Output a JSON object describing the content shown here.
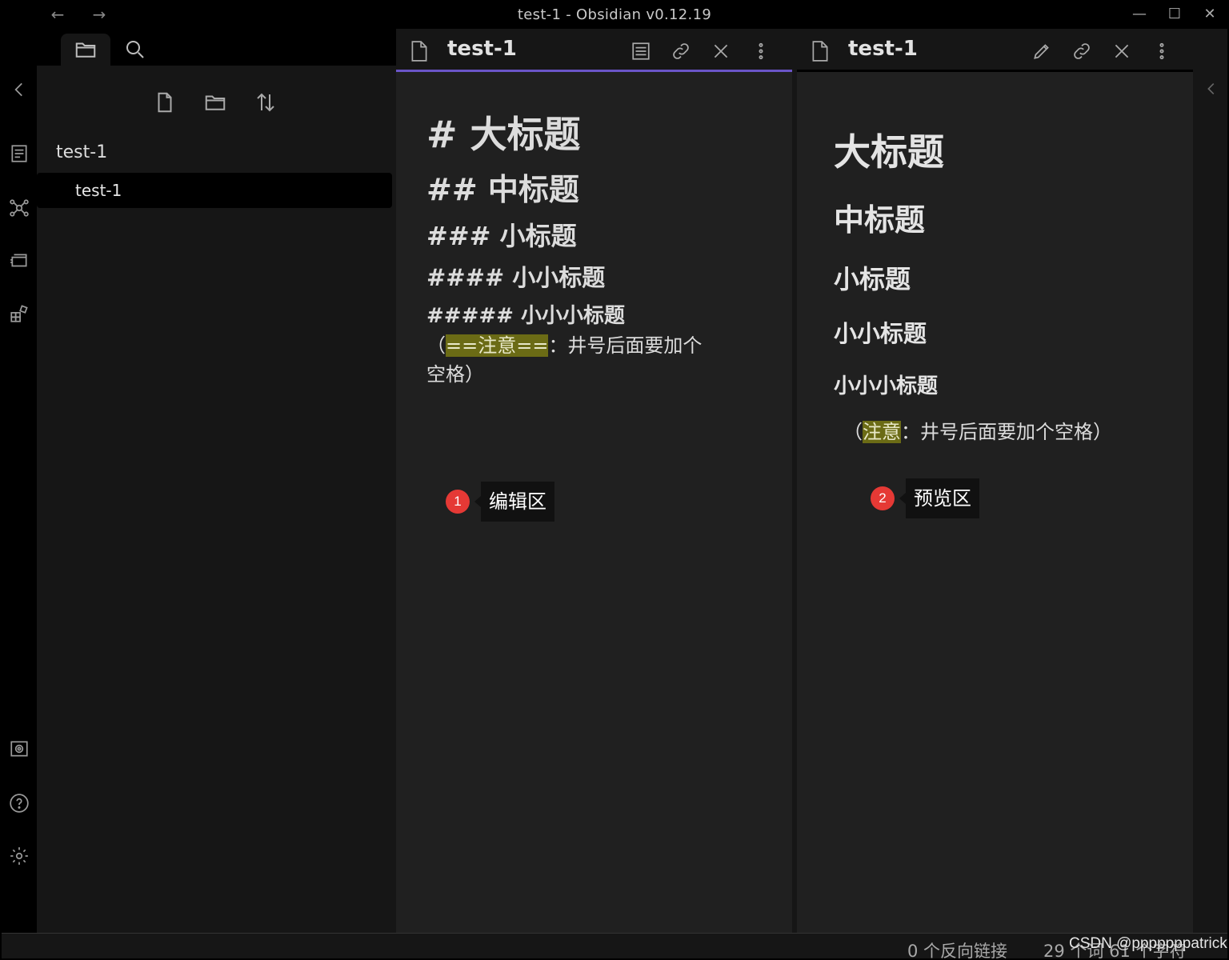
{
  "window": {
    "title": "test-1 - Obsidian v0.12.19"
  },
  "titlebar": {
    "back_icon": "arrow-left-icon",
    "forward_icon": "arrow-right-icon",
    "minimize": "—",
    "maximize": "☐",
    "close": "✕"
  },
  "ribbon": {
    "icons": [
      "collapse-left-icon",
      "quick-switcher-icon",
      "graph-view-icon",
      "slides-icon",
      "plugins-icon",
      "vault-icon",
      "help-icon",
      "settings-icon"
    ]
  },
  "sidebar": {
    "tabs": [
      "file-explorer-icon",
      "search-icon"
    ],
    "actions": [
      "new-note-icon",
      "new-folder-icon",
      "sort-icon"
    ],
    "folder": "test-1",
    "file": "test-1"
  },
  "editor": {
    "title": "test-1",
    "h1": "# 大标题",
    "h2": "## 中标题",
    "h3": "### 小标题",
    "h4": "#### 小小标题",
    "h5": "##### 小小小标题",
    "note_open": "（",
    "note_highlight": "==注意==",
    "note_rest": "：井号后面要加个空格）"
  },
  "preview": {
    "title": "test-1",
    "h1": "大标题",
    "h2": "中标题",
    "h3": "小标题",
    "h4": "小小标题",
    "h5": "小小小标题",
    "note_open": "（",
    "note_highlight": "注意",
    "note_rest": "：井号后面要加个空格）"
  },
  "callouts": [
    {
      "num": "1",
      "label": "编辑区"
    },
    {
      "num": "2",
      "label": "预览区"
    }
  ],
  "statusbar": {
    "backlinks": "0 个反向链接",
    "counts": "29 个词 61 个字符"
  },
  "watermark": "CSDN @pppppppatrick",
  "colors": {
    "accent": "#6a55c7",
    "highlight": "#6b6b15",
    "callout": "#e53935"
  }
}
